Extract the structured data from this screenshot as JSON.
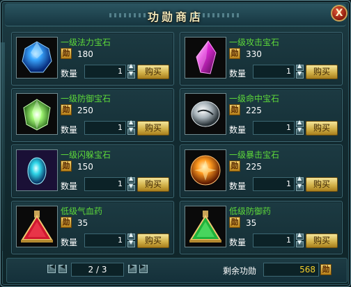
{
  "window": {
    "title": "功勋商店",
    "close_label": "X"
  },
  "labels": {
    "merit_badge": "勋",
    "qty_label": "数量",
    "buy_label": "购买",
    "step_up": "▲",
    "step_down": "▼"
  },
  "items": [
    {
      "name": "一级法力宝石",
      "price": "180",
      "qty": "1",
      "icon": "blue-mana-gem-icon"
    },
    {
      "name": "一级攻击宝石",
      "price": "330",
      "qty": "1",
      "icon": "purple-attack-gem-icon"
    },
    {
      "name": "一级防御宝石",
      "price": "250",
      "qty": "1",
      "icon": "green-defense-gem-icon"
    },
    {
      "name": "一级命中宝石",
      "price": "225",
      "qty": "1",
      "icon": "silver-accuracy-gem-icon"
    },
    {
      "name": "一级闪躲宝石",
      "price": "150",
      "qty": "1",
      "icon": "cyan-dodge-gem-icon"
    },
    {
      "name": "一级暴击宝石",
      "price": "225",
      "qty": "1",
      "icon": "orange-crit-gem-icon"
    },
    {
      "name": "低级气血药",
      "price": "35",
      "qty": "1",
      "icon": "red-health-potion-icon"
    },
    {
      "name": "低级防御药",
      "price": "35",
      "qty": "1",
      "icon": "green-defense-potion-icon"
    }
  ],
  "pagination": {
    "page": "2 / 3",
    "first": "|◀",
    "prev": "◀",
    "next": "▶",
    "last": "▶|"
  },
  "footer": {
    "remaining_label": "剩余功勋",
    "remaining_value": "568"
  },
  "colors": {
    "name_green": "#5dd83a",
    "remaining_yellow": "#f5cf2a",
    "buy_gold": "#d2b24a"
  }
}
